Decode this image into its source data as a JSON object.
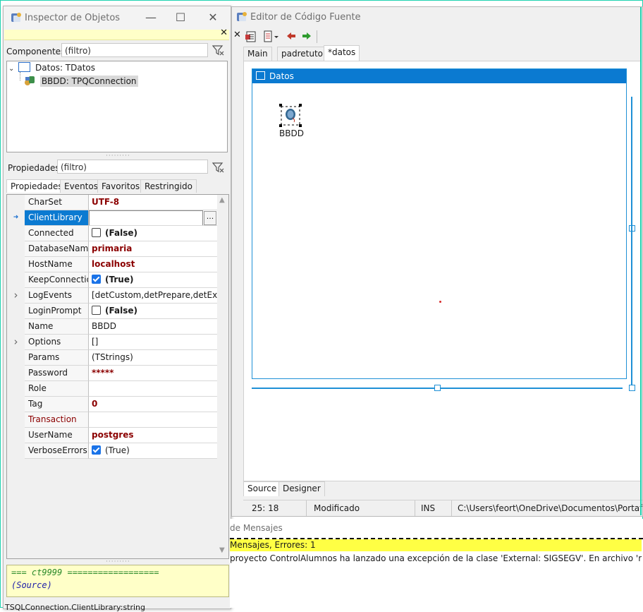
{
  "object_inspector": {
    "title": "Inspector de Objetos",
    "components_label": "Componentes",
    "components_filter_placeholder": "(filtro)",
    "tree": [
      {
        "label": "Datos: TDatos",
        "icon": "form-icon"
      },
      {
        "label": "BBDD: TPQConnection",
        "icon": "connection-icon"
      }
    ],
    "properties_label": "Propiedades",
    "properties_filter_placeholder": "(filtro)",
    "tabs": [
      "Propiedades",
      "Eventos",
      "Favoritos",
      "Restringido"
    ],
    "properties": [
      {
        "name": "CharSet",
        "value": "UTF-8",
        "style": "bold-red"
      },
      {
        "name": "ClientLibrary",
        "value": "",
        "style": "editor"
      },
      {
        "name": "Connected",
        "value": "(False)",
        "style": "check-bold",
        "checked": false
      },
      {
        "name": "DatabaseName",
        "value": "primaria",
        "style": "bold-red"
      },
      {
        "name": "HostName",
        "value": "localhost",
        "style": "bold-red"
      },
      {
        "name": "KeepConnection",
        "value": "(True)",
        "style": "check-bold",
        "checked": true
      },
      {
        "name": "LogEvents",
        "value": "[detCustom,detPrepare,detExecut",
        "style": "plain",
        "expand": true
      },
      {
        "name": "LoginPrompt",
        "value": "(False)",
        "style": "check-bold",
        "checked": false
      },
      {
        "name": "Name",
        "value": "BBDD",
        "style": "plain"
      },
      {
        "name": "Options",
        "value": "[]",
        "style": "plain",
        "expand": true
      },
      {
        "name": "Params",
        "value": "(TStrings)",
        "style": "plain"
      },
      {
        "name": "Password",
        "value": "*****",
        "style": "bold-red"
      },
      {
        "name": "Role",
        "value": "",
        "style": "plain"
      },
      {
        "name": "Tag",
        "value": "0",
        "style": "bold-red"
      },
      {
        "name": "Transaction",
        "value": "",
        "style": "red-name"
      },
      {
        "name": "UserName",
        "value": "postgres",
        "style": "bold-red"
      },
      {
        "name": "VerboseErrors",
        "value": "(True)",
        "style": "check",
        "checked": true
      }
    ],
    "hint_line1": "=== ct9999 ==================",
    "hint_line2": "(Source)",
    "bottom_status": "TSQLConnection.ClientLibrary:string"
  },
  "source_editor": {
    "title": "Editor de Código Fuente",
    "tabs": [
      "Main",
      "padretutor",
      "*datos"
    ],
    "form_title": "Datos",
    "component_label": "BBDD",
    "bottom_tabs": [
      "Source",
      "Designer"
    ],
    "status": {
      "position": "25: 18",
      "state": "Modificado",
      "mode": "INS",
      "path": "C:\\Users\\feort\\OneDrive\\Documentos\\Portafolios\\"
    }
  },
  "messages": {
    "title": "de Mensajes",
    "header": "Mensajes, Errores: 1",
    "line": "proyecto ControlAlumnos ha lanzado una excepción de la clase 'External: SIGSEGV'.  En archivo 'main.pas' en lin"
  },
  "colors": {
    "accent": "#0b7ad1",
    "value_red": "#8b0000",
    "highlight_yellow": "#ffffc8",
    "message_yellow": "#ffff44"
  }
}
